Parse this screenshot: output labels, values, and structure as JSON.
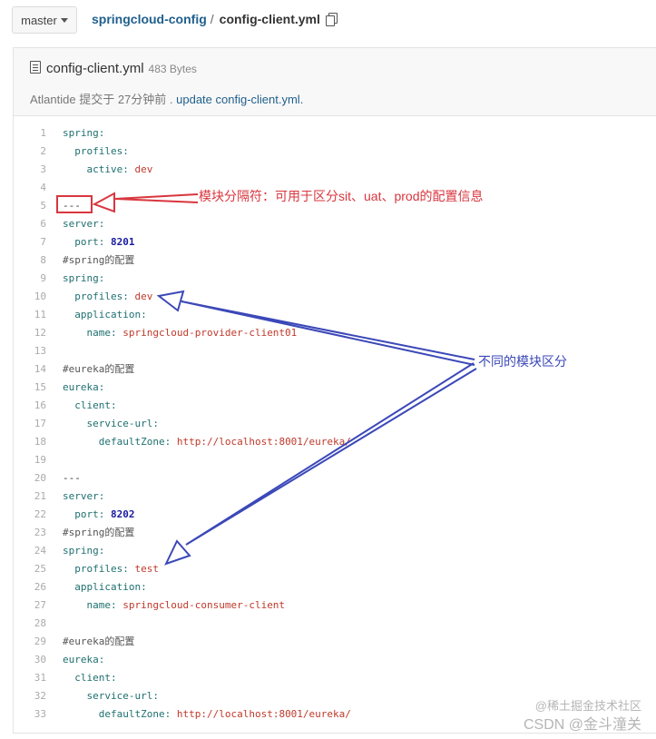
{
  "branch": {
    "label": "master"
  },
  "breadcrumb": {
    "repo": "springcloud-config",
    "separator": "/",
    "file": "config-client.yml"
  },
  "file": {
    "name": "config-client.yml",
    "size": "483 Bytes",
    "commit_author": "Atlantide",
    "commit_meta": " 提交于 27分钟前 . ",
    "commit_message": "update config-client.yml."
  },
  "code_lines": [
    {
      "n": "1",
      "indent": "",
      "key": "spring:",
      "val": ""
    },
    {
      "n": "2",
      "indent": "  ",
      "key": "profiles:",
      "val": ""
    },
    {
      "n": "3",
      "indent": "    ",
      "key": "active:",
      "val": " dev"
    },
    {
      "n": "4",
      "indent": "",
      "key": "",
      "val": ""
    },
    {
      "n": "5",
      "indent": "",
      "key": "",
      "val": "",
      "plain": "---"
    },
    {
      "n": "6",
      "indent": "",
      "key": "server:",
      "val": ""
    },
    {
      "n": "7",
      "indent": "  ",
      "key": "port:",
      "num": " 8201"
    },
    {
      "n": "8",
      "indent": "",
      "comment": "#spring的配置"
    },
    {
      "n": "9",
      "indent": "",
      "key": "spring:",
      "val": ""
    },
    {
      "n": "10",
      "indent": "  ",
      "key": "profiles:",
      "val": " dev"
    },
    {
      "n": "11",
      "indent": "  ",
      "key": "application:",
      "val": ""
    },
    {
      "n": "12",
      "indent": "    ",
      "key": "name:",
      "val": " springcloud-provider-client01"
    },
    {
      "n": "13",
      "indent": "",
      "key": "",
      "val": ""
    },
    {
      "n": "14",
      "indent": "",
      "comment": "#eureka的配置"
    },
    {
      "n": "15",
      "indent": "",
      "key": "eureka:",
      "val": ""
    },
    {
      "n": "16",
      "indent": "  ",
      "key": "client:",
      "val": ""
    },
    {
      "n": "17",
      "indent": "    ",
      "key": "service-url:",
      "val": ""
    },
    {
      "n": "18",
      "indent": "      ",
      "key": "defaultZone:",
      "val": " http://localhost:8001/eureka/"
    },
    {
      "n": "19",
      "indent": "",
      "key": "",
      "val": ""
    },
    {
      "n": "20",
      "indent": "",
      "plain": "---"
    },
    {
      "n": "21",
      "indent": "",
      "key": "server:",
      "val": ""
    },
    {
      "n": "22",
      "indent": "  ",
      "key": "port:",
      "num": " 8202"
    },
    {
      "n": "23",
      "indent": "",
      "comment": "#spring的配置"
    },
    {
      "n": "24",
      "indent": "",
      "key": "spring:",
      "val": ""
    },
    {
      "n": "25",
      "indent": "  ",
      "key": "profiles:",
      "val": " test"
    },
    {
      "n": "26",
      "indent": "  ",
      "key": "application:",
      "val": ""
    },
    {
      "n": "27",
      "indent": "    ",
      "key": "name:",
      "val": " springcloud-consumer-client"
    },
    {
      "n": "28",
      "indent": "",
      "key": "",
      "val": ""
    },
    {
      "n": "29",
      "indent": "",
      "comment": "#eureka的配置"
    },
    {
      "n": "30",
      "indent": "",
      "key": "eureka:",
      "val": ""
    },
    {
      "n": "31",
      "indent": "  ",
      "key": "client:",
      "val": ""
    },
    {
      "n": "32",
      "indent": "    ",
      "key": "service-url:",
      "val": ""
    },
    {
      "n": "33",
      "indent": "      ",
      "key": "defaultZone:",
      "val": " http://localhost:8001/eureka/"
    }
  ],
  "annotations": {
    "red_note": "模块分隔符：可用于区分sit、uat、prod的配置信息",
    "blue_note": "不同的模块区分"
  },
  "watermark": {
    "line1": "@稀土掘金技术社区",
    "line2": "CSDN @金斗潼关"
  },
  "colors": {
    "annotation_red": "#d9363e",
    "annotation_blue": "#3b48b8",
    "link": "#1f5f8c"
  }
}
